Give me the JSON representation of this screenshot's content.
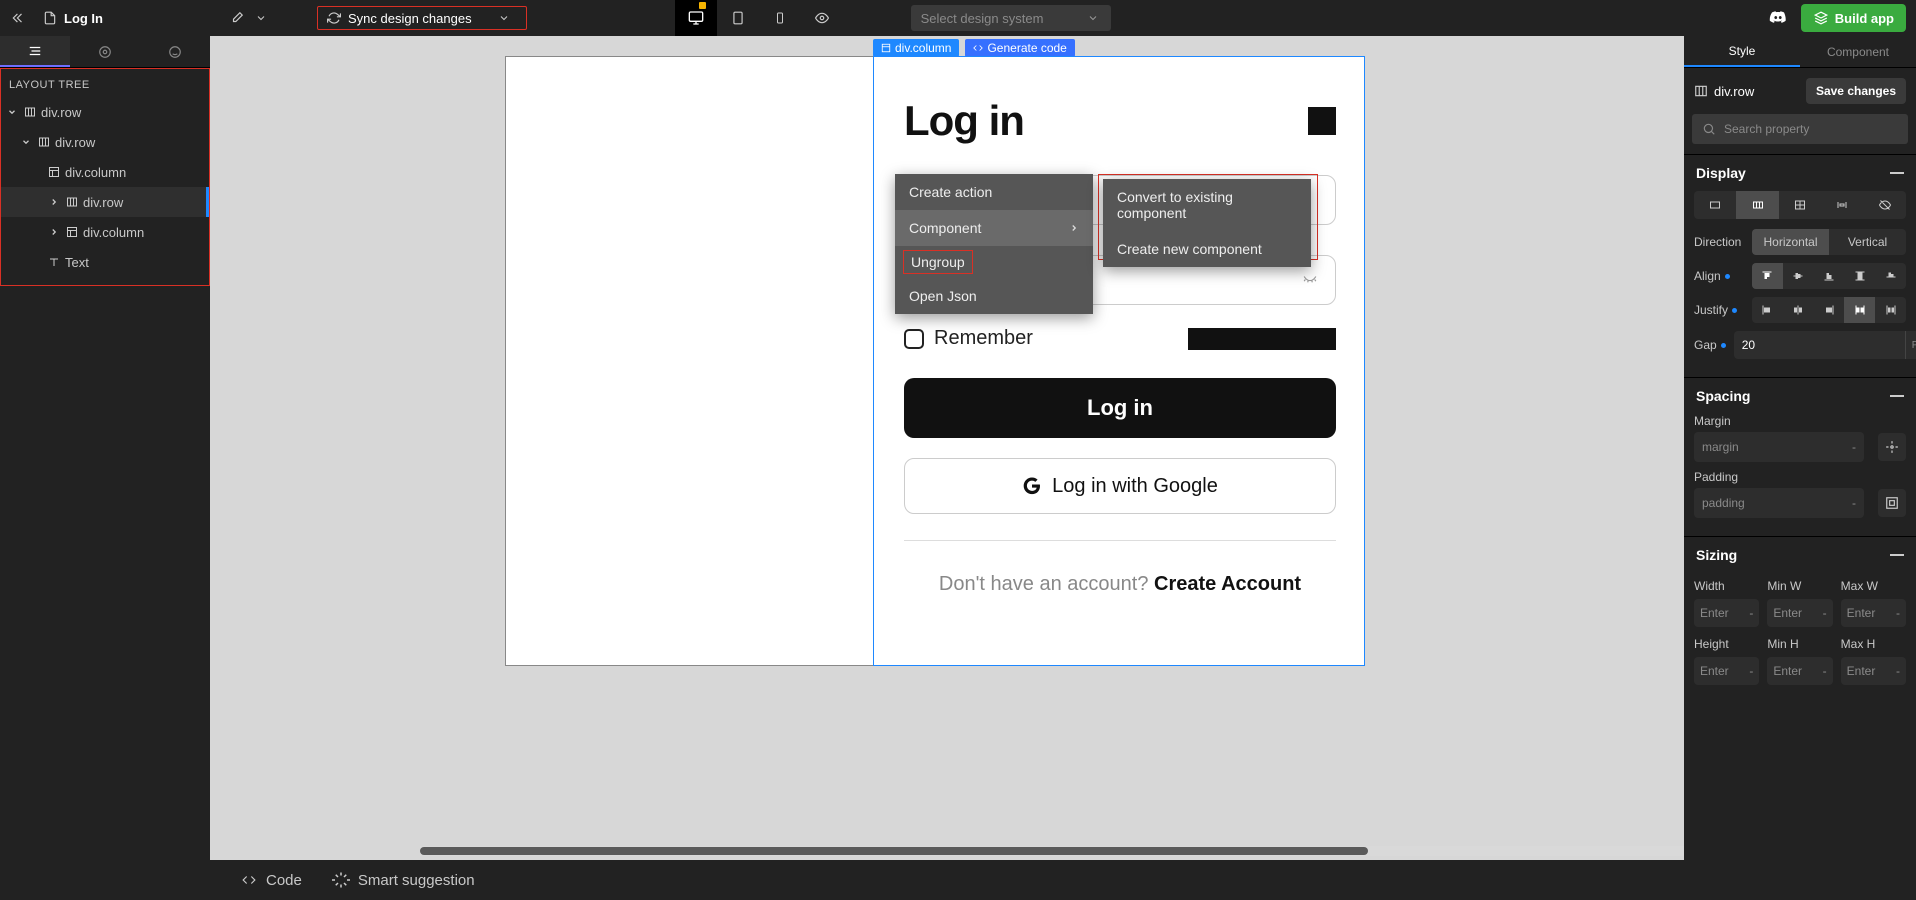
{
  "topbar": {
    "doc_name": "Log In",
    "sync_label": "Sync design changes",
    "design_system_placeholder": "Select design system",
    "build_label": "Build app"
  },
  "left": {
    "header": "LAYOUT TREE",
    "nodes": [
      {
        "label": "div.row",
        "icon": "columns",
        "depth": 0,
        "expand": "down"
      },
      {
        "label": "div.row",
        "icon": "columns",
        "depth": 1,
        "expand": "down"
      },
      {
        "label": "div.column",
        "icon": "layout",
        "depth": 2,
        "expand": "none"
      },
      {
        "label": "div.row",
        "icon": "columns",
        "depth": 3,
        "expand": "right",
        "selected": true
      },
      {
        "label": "div.column",
        "icon": "layout",
        "depth": 3,
        "expand": "right"
      },
      {
        "label": "Text",
        "icon": "text",
        "depth": 2,
        "expand": "none"
      }
    ]
  },
  "canvas": {
    "sel_chip_main": "div.column",
    "sel_chip_gen": "Generate code",
    "login": {
      "title": "Log in",
      "remember": "Remember",
      "login_btn": "Log in",
      "google_btn": "Log in with Google",
      "bottom_q": "Don't have an account? ",
      "bottom_cta": "Create Account"
    },
    "ctx": {
      "create_action": "Create action",
      "component": "Component",
      "ungroup": "Ungroup",
      "open_json": "Open Json",
      "convert": "Convert to existing component",
      "create_new": "Create new component"
    }
  },
  "bottombar": {
    "code": "Code",
    "smart": "Smart suggestion"
  },
  "right": {
    "tabs": {
      "style": "Style",
      "component": "Component"
    },
    "selected_el": "div.row",
    "save": "Save changes",
    "search_placeholder": "Search property",
    "sections": {
      "display": "Display",
      "spacing": "Spacing",
      "sizing": "Sizing"
    },
    "display": {
      "direction_label": "Direction",
      "direction_h": "Horizontal",
      "direction_v": "Vertical",
      "align_label": "Align",
      "justify_label": "Justify",
      "gap_label": "Gap",
      "gap_value": "20",
      "gap_unit": "PX"
    },
    "spacing": {
      "margin_label": "Margin",
      "margin_ph": "margin",
      "padding_label": "Padding",
      "padding_ph": "padding"
    },
    "sizing": {
      "width": "Width",
      "minw": "Min W",
      "maxw": "Max W",
      "height": "Height",
      "minh": "Min H",
      "maxh": "Max H",
      "enter": "Enter"
    }
  }
}
